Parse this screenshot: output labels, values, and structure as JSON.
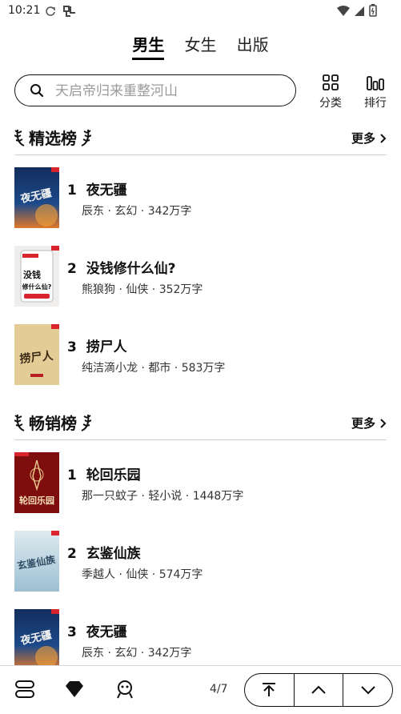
{
  "status_bar": {
    "time": "10:21"
  },
  "tabs": [
    {
      "label": "男生",
      "active": true
    },
    {
      "label": "女生",
      "active": false
    },
    {
      "label": "出版",
      "active": false
    }
  ],
  "search": {
    "placeholder": "天启帝归来重整河山"
  },
  "tools": {
    "category_label": "分类",
    "rank_label": "排行"
  },
  "sections": [
    {
      "title": "精选榜",
      "more_label": "更多",
      "books": [
        {
          "rank": "1",
          "title": "夜无疆",
          "meta": "辰东 · 玄幻 · 342万字"
        },
        {
          "rank": "2",
          "title": "没钱修什么仙?",
          "meta": "熊狼狗 · 仙侠 · 352万字"
        },
        {
          "rank": "3",
          "title": "捞尸人",
          "meta": "纯洁滴小龙 · 都市 · 583万字"
        }
      ]
    },
    {
      "title": "畅销榜",
      "more_label": "更多",
      "books": [
        {
          "rank": "1",
          "title": "轮回乐园",
          "meta": "那一只蚊子 · 轻小说 · 1448万字"
        },
        {
          "rank": "2",
          "title": "玄鉴仙族",
          "meta": "季越人 · 仙侠 · 574万字"
        },
        {
          "rank": "3",
          "title": "夜无疆",
          "meta": "辰东 · 玄幻 · 342万字"
        }
      ]
    }
  ],
  "covers": {
    "c1": "夜无疆",
    "c2a": "没钱",
    "c2b": "修什么仙?",
    "c3": "捞尸人",
    "c4": "轮回乐园",
    "c5": "玄鉴仙族"
  },
  "bottom": {
    "page_indicator": "4/7"
  }
}
